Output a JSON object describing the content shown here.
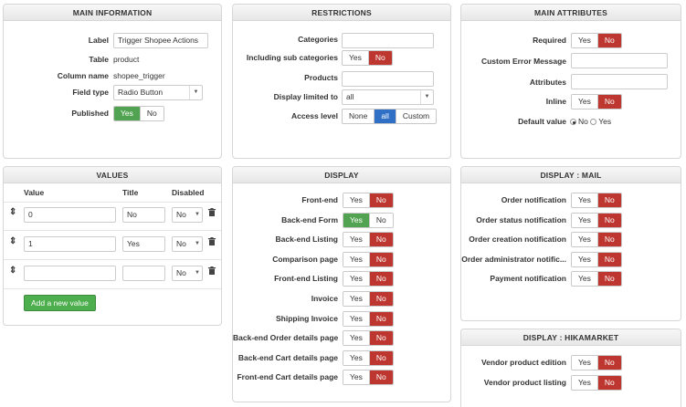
{
  "main_information": {
    "title": "MAIN INFORMATION",
    "label_label": "Label",
    "label_value": "Trigger Shopee Actions",
    "table_label": "Table",
    "table_value": "product",
    "column_label": "Column name",
    "column_value": "shopee_trigger",
    "field_type_label": "Field type",
    "field_type_value": "Radio Button",
    "published_label": "Published",
    "published_yes": "Yes",
    "published_no": "No"
  },
  "restrictions": {
    "title": "RESTRICTIONS",
    "categories_label": "Categories",
    "categories_value": "",
    "sub_label": "Including sub categories",
    "sub_yes": "Yes",
    "sub_no": "No",
    "products_label": "Products",
    "products_value": "",
    "display_limited_label": "Display limited to",
    "display_limited_value": "all",
    "access_label": "Access level",
    "access_none": "None",
    "access_all": "all",
    "access_custom": "Custom"
  },
  "main_attributes": {
    "title": "MAIN ATTRIBUTES",
    "required_label": "Required",
    "required_yes": "Yes",
    "required_no": "No",
    "custom_error_label": "Custom Error Message",
    "custom_error_value": "",
    "attributes_label": "Attributes",
    "attributes_value": "",
    "inline_label": "Inline",
    "inline_yes": "Yes",
    "inline_no": "No",
    "default_label": "Default value",
    "default_no": "No",
    "default_yes": "Yes"
  },
  "values": {
    "title": "VALUES",
    "col_value": "Value",
    "col_title": "Title",
    "col_disabled": "Disabled",
    "rows": [
      {
        "value": "0",
        "title": "No",
        "disabled": "No"
      },
      {
        "value": "1",
        "title": "Yes",
        "disabled": "No"
      },
      {
        "value": "",
        "title": "",
        "disabled": "No"
      }
    ],
    "add_button": "Add a new value"
  },
  "display": {
    "title": "DISPLAY",
    "rows": [
      {
        "label": "Front-end",
        "yes": "Yes",
        "no": "No",
        "selected": "no"
      },
      {
        "label": "Back-end Form",
        "yes": "Yes",
        "no": "No",
        "selected": "yes"
      },
      {
        "label": "Back-end Listing",
        "yes": "Yes",
        "no": "No",
        "selected": "no"
      },
      {
        "label": "Comparison page",
        "yes": "Yes",
        "no": "No",
        "selected": "no"
      },
      {
        "label": "Front-end Listing",
        "yes": "Yes",
        "no": "No",
        "selected": "no"
      },
      {
        "label": "Invoice",
        "yes": "Yes",
        "no": "No",
        "selected": "no"
      },
      {
        "label": "Shipping Invoice",
        "yes": "Yes",
        "no": "No",
        "selected": "no"
      },
      {
        "label": "Back-end Order details page",
        "yes": "Yes",
        "no": "No",
        "selected": "no"
      },
      {
        "label": "Back-end Cart details page",
        "yes": "Yes",
        "no": "No",
        "selected": "no"
      },
      {
        "label": "Front-end Cart details page",
        "yes": "Yes",
        "no": "No",
        "selected": "no"
      }
    ]
  },
  "display_mail": {
    "title": "DISPLAY : MAIL",
    "rows": [
      {
        "label": "Order notification",
        "yes": "Yes",
        "no": "No"
      },
      {
        "label": "Order status notification",
        "yes": "Yes",
        "no": "No"
      },
      {
        "label": "Order creation notification",
        "yes": "Yes",
        "no": "No"
      },
      {
        "label": "Order administrator notific...",
        "yes": "Yes",
        "no": "No"
      },
      {
        "label": "Payment notification",
        "yes": "Yes",
        "no": "No"
      }
    ]
  },
  "display_hikamarket": {
    "title": "DISPLAY : HIKAMARKET",
    "rows": [
      {
        "label": "Vendor product edition",
        "yes": "Yes",
        "no": "No"
      },
      {
        "label": "Vendor product listing",
        "yes": "Yes",
        "no": "No"
      }
    ]
  },
  "colors": {
    "no_active": "#bd362f",
    "yes_active": "#51a351",
    "all_active": "#2f6fc6",
    "add_button": "#4cae4c"
  }
}
